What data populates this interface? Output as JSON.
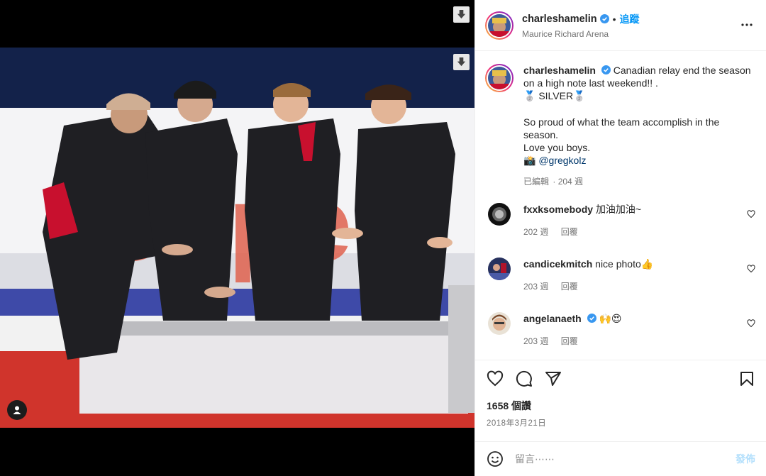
{
  "post": {
    "username": "charleshamelin",
    "follow_label": "追蹤",
    "separator": "•",
    "location": "Maurice Richard Arena",
    "more_icon": "more-horizontal-icon"
  },
  "media": {
    "download_icon": "download-icon",
    "tag_icon": "user-tag-icon",
    "photo_description_colors": {
      "jacket": "#1f1f23",
      "accent_red": "#c8102e",
      "podium": "#e9e7ea"
    }
  },
  "caption": {
    "username": "charleshamelin",
    "lines": [
      "Canadian relay end the season on a high note last weekend!! .",
      "🥈 SILVER🥈",
      "",
      "So proud of what the team accomplish in the season.",
      "Love you boys.",
      "📸 "
    ],
    "mention": "@gregkolz",
    "edited": "已編輯",
    "age": "· 204 週"
  },
  "comments": [
    {
      "username": "fxxksomebody",
      "verified": false,
      "text": "加油加油~",
      "age": "202 週",
      "reply": "回覆"
    },
    {
      "username": "candicekmitch",
      "verified": false,
      "text": "nice photo👍",
      "age": "203 週",
      "reply": "回覆"
    },
    {
      "username": "angelanaeth",
      "verified": true,
      "text": "🙌😍",
      "age": "203 週",
      "reply": "回覆"
    }
  ],
  "actions": {
    "like_icon": "heart-icon",
    "comment_icon": "comment-icon",
    "share_icon": "share-icon",
    "save_icon": "bookmark-icon",
    "likes": "1658 個讚",
    "date": "2018年3月21日"
  },
  "comment_box": {
    "emoji_icon": "emoji-icon",
    "placeholder": "留言⋯⋯",
    "post_label": "發佈"
  },
  "colors": {
    "accent": "#0095f6",
    "verified": "#3897f0",
    "muted": "#737373",
    "post_disabled": "#b2dffc"
  }
}
